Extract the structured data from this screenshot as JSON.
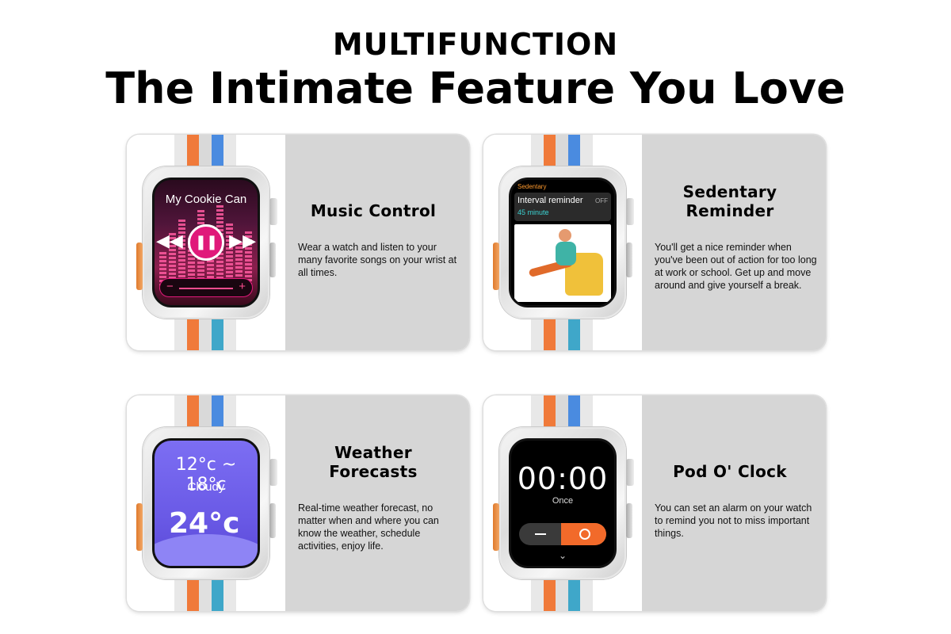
{
  "header": {
    "kicker": "MULTIFUNCTION",
    "title": "The Intimate Feature You Love"
  },
  "features": [
    {
      "title_lines": [
        "Music Control"
      ],
      "description": "Wear a watch and listen to your many favorite songs on your wrist at all times.",
      "screen": {
        "song": "My Cookie Can",
        "prev": "◀◀",
        "play": "❚❚",
        "next": "▶▶",
        "minus": "−",
        "plus": "+"
      }
    },
    {
      "title_lines": [
        "Sedentary",
        "Reminder"
      ],
      "description": "You'll get a nice reminder when you've been out of action for too long at work or school. Get up and move around and give yourself a break.",
      "screen": {
        "header": "Sedentary",
        "setting": "Interval reminder",
        "state": "OFF",
        "value": "45 minute"
      }
    },
    {
      "title_lines": [
        "Weather",
        "Forecasts"
      ],
      "description": "Real-time weather forecast, no matter when and where you can know the weather, schedule activities, enjoy life.",
      "screen": {
        "range": "12°c ~ 18°c",
        "condition": "Cloudy",
        "current": "24°c"
      }
    },
    {
      "title_lines": [
        "Pod O' Clock"
      ],
      "description": "You can set an alarm on your watch to remind you not to miss important things.",
      "screen": {
        "time": "00:00",
        "repeat": "Once",
        "chevron": "⌄"
      }
    }
  ],
  "colors": {
    "panel": "#d6d6d6",
    "music_accent": "#e0197a",
    "alarm_accent": "#f26a2a",
    "weather_bg": "#6a5ae6"
  }
}
